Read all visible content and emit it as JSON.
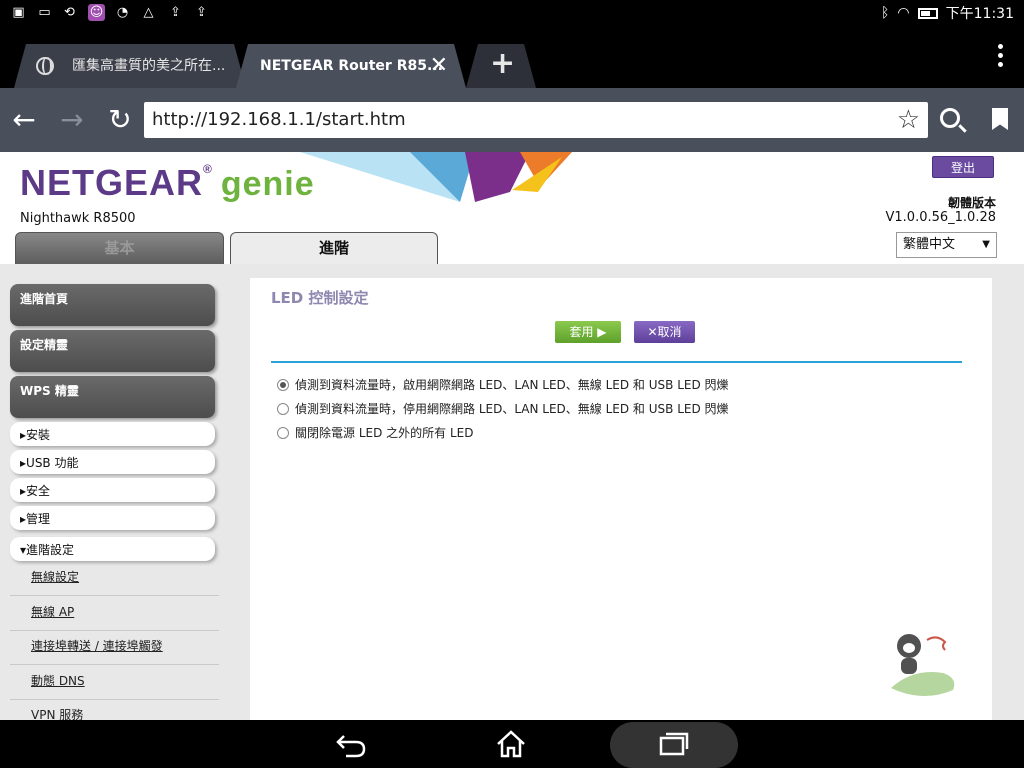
{
  "statusbar": {
    "time": "下午11:31"
  },
  "browser": {
    "tabs": [
      {
        "label": "匯集高畫質的美之所在..."
      },
      {
        "label": "NETGEAR Router R85..."
      }
    ],
    "url": "http://192.168.1.1/start.htm"
  },
  "router": {
    "brand": "NETGEAR",
    "brand_mark": "®",
    "product": "genie",
    "model": "Nighthawk R8500",
    "logout_label": "登出",
    "firmware_label": "韌體版本",
    "firmware_version": "V1.0.0.56_1.0.28",
    "language": "繁體中文",
    "tabs": {
      "basic": "基本",
      "advanced": "進階"
    }
  },
  "sidebar": {
    "main_items": [
      "進階首頁",
      "設定精靈",
      "WPS 精靈"
    ],
    "sections": [
      "安裝",
      "USB 功能",
      "安全",
      "管理",
      "進階設定"
    ],
    "sub_links": [
      "無線設定",
      "無線 AP",
      "連接埠轉送 / 連接埠觸發",
      "動態 DNS",
      "VPN 服務"
    ]
  },
  "content": {
    "title": "LED 控制設定",
    "apply_label": "套用 ▶",
    "cancel_label": "✕取消",
    "options": [
      {
        "label": "偵測到資料流量時，啟用網際網路 LED、LAN LED、無線 LED 和 USB LED 閃爍",
        "selected": true
      },
      {
        "label": "偵測到資料流量時，停用網際網路 LED、LAN LED、無線 LED 和 USB LED 閃爍",
        "selected": false
      },
      {
        "label": "關閉除電源 LED 之外的所有 LED",
        "selected": false
      }
    ]
  },
  "colors": {
    "brand_purple": "#5d3a87",
    "brand_green": "#6fb33f",
    "apply_green": "#6fae35",
    "cancel_purple": "#6a4ba0",
    "divider_blue": "#29a3d8"
  }
}
